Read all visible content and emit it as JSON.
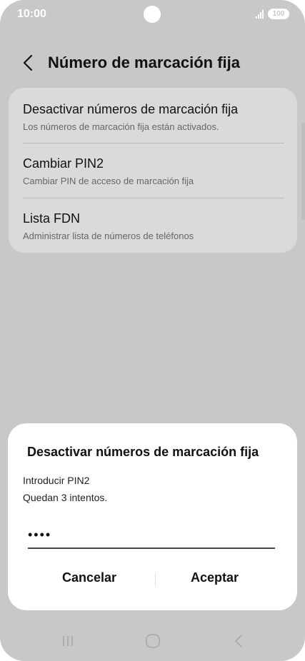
{
  "status_bar": {
    "time": "10:00",
    "battery": "100"
  },
  "header": {
    "title": "Número de marcación fija"
  },
  "settings": {
    "items": [
      {
        "title": "Desactivar números de marcación fija",
        "subtitle": "Los números de marcación fija están activados."
      },
      {
        "title": "Cambiar PIN2",
        "subtitle": "Cambiar PIN de acceso de marcación fija"
      },
      {
        "title": "Lista FDN",
        "subtitle": "Administrar lista de números de teléfonos"
      }
    ]
  },
  "dialog": {
    "title": "Desactivar números de marcación fija",
    "prompt": "Introducir PIN2",
    "attempts": "Quedan 3 intentos.",
    "pin_value": "••••",
    "cancel_label": "Cancelar",
    "accept_label": "Aceptar"
  },
  "icons": {
    "back": "back-arrow-icon",
    "signal": "signal-icon",
    "battery": "battery-icon",
    "recent": "recent-apps-icon",
    "home": "home-icon",
    "nav_back": "nav-back-icon"
  },
  "colors": {
    "overlay_background": "#c8c8c8",
    "dialog_background": "#ffffff"
  }
}
